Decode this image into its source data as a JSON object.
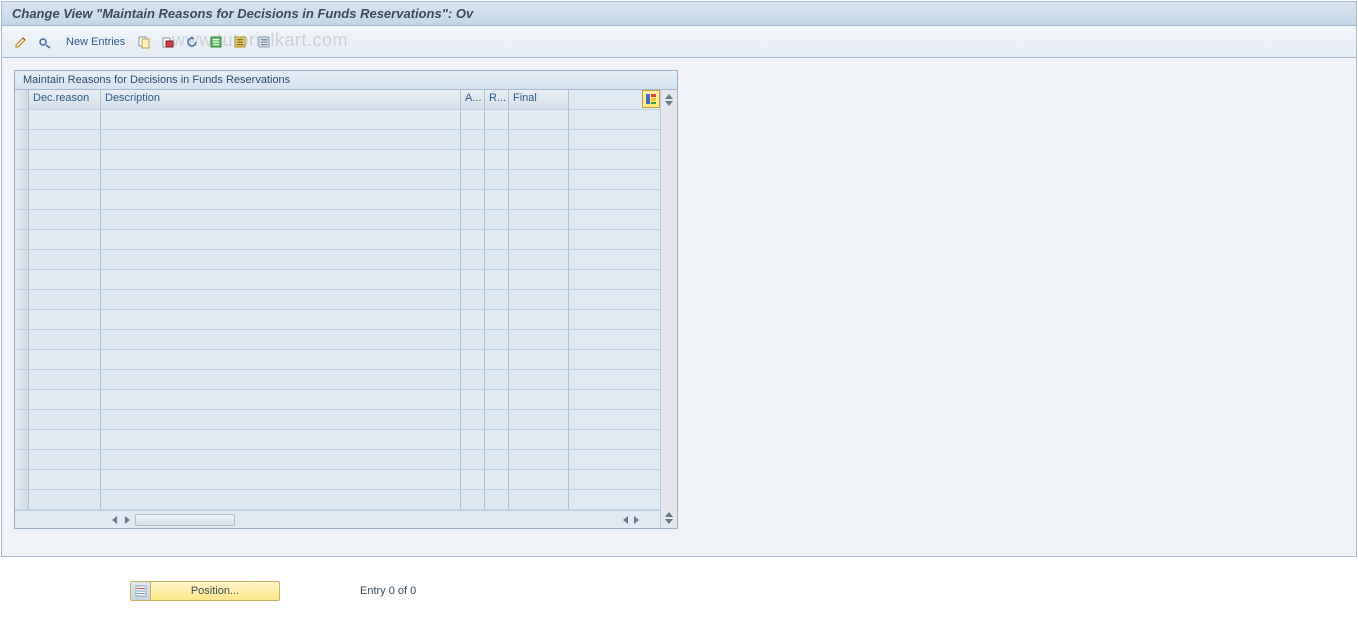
{
  "title": "Change View \"Maintain Reasons for Decisions in Funds Reservations\": Ov",
  "toolbar": {
    "new_entries_label": "New Entries"
  },
  "watermark": "www.tutorialkart.com",
  "panel": {
    "title": "Maintain Reasons for Decisions in Funds Reservations",
    "columns": {
      "dec_reason": "Dec.reason",
      "description": "Description",
      "a": "A...",
      "r": "R...",
      "final": "Final"
    },
    "row_count": 20
  },
  "footer": {
    "position_label": "Position...",
    "entry_text": "Entry 0 of 0"
  }
}
